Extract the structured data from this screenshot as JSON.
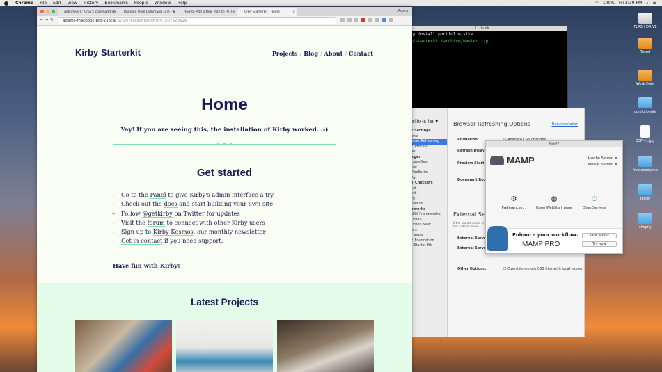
{
  "menubar": {
    "items": [
      "Chrome",
      "File",
      "Edit",
      "View",
      "History",
      "Bookmarks",
      "People",
      "Window",
      "Help"
    ],
    "status": "100%",
    "clock": "Fri 3:39 PM"
  },
  "desktop": {
    "icons": [
      "FLASH DRIVE",
      "Travel",
      "Work Data",
      "portfolio-site",
      "33P—1.jpg",
      "freelancejump",
      "tester",
      "shopify"
    ]
  },
  "terminal": {
    "title": "1. bash",
    "lines": [
      "y install portfolio-site",
      "/starterkit/archive/master.zip"
    ]
  },
  "codekit": {
    "project": "olio-site",
    "sidebar": [
      {
        "t": "t Settings",
        "s": true
      },
      {
        "t": "eral"
      },
      {
        "t": "wser Refreshing",
        "sel": true
      },
      {
        "t": "d Process"
      },
      {
        "t": "ks"
      },
      {
        "t": "ages",
        "s": true
      },
      {
        "t": ""
      },
      {
        "t": "toprefixer"
      },
      {
        "t": "bel"
      },
      {
        "t": "ffeeScript"
      },
      {
        "t": "Py"
      },
      {
        "t": "x Checkers",
        "s": true
      },
      {
        "t": "int"
      },
      {
        "t": "int"
      },
      {
        "t": "nt"
      },
      {
        "t": "feeLint"
      },
      {
        "t": "eworks",
        "s": true
      },
      {
        "t": "eKit Frameworks"
      },
      {
        "t": "urbon"
      },
      {
        "t": "urbon Neat"
      },
      {
        "t": "ars"
      },
      {
        "t": "mpass"
      },
      {
        "t": "b Foundation"
      },
      {
        "t": ""
      },
      {
        "t": "- Starter Kit"
      }
    ],
    "heading": "Browser Refreshing Options",
    "documentation": "Documentation",
    "animation_label": "Animation:",
    "animation_value": "Animate CSS changes",
    "refresh_delay": "Refresh Delay:",
    "preview_path": "Preview Start Path",
    "preview_root": "Document Root S",
    "external_heading": "External Serve",
    "external_text": "If the project needs se and tell CodeKit where",
    "ext_url": "External Server Ur",
    "ext_addr": "External Server Ad",
    "other_label": "Other Options:",
    "other_value": "Override remote CSS files with local copies"
  },
  "mamp": {
    "title": "MAMP",
    "logo": "MAMP",
    "apache": "Apache Server",
    "mysql": "MySQL Server",
    "preferences": "Preferences...",
    "webstart": "Open WebStart page",
    "stop": "Stop Servers",
    "promo_title": "Enhance your workflow:",
    "promo_product": "MAMP PRO",
    "tour": "Take a tour",
    "trynow": "Try now"
  },
  "browser": {
    "tabs": [
      {
        "label": "getkirby/cli: Kirby's command lin"
      },
      {
        "label": "Running from Command Line - Ki"
      },
      {
        "label": "How to Add a New Path to PATH"
      },
      {
        "label": "Kirby Starterkit | Home"
      }
    ],
    "user": "Adam",
    "url_host": "adams-macbook-pro-2.local",
    "url_rest": ":5757/?ckcachecontrol=1507329526"
  },
  "site": {
    "brand": "Kirby Starterkit",
    "menu": [
      "Projects",
      "Blog",
      "About",
      "Contact"
    ],
    "title": "Home",
    "intro": "Yay! If you are seeing this, the installation of Kirby worked. :-)",
    "get_started": "Get started",
    "list": [
      {
        "pre": "Go to the ",
        "link": "Panel",
        "post": " to give Kirby's admin interface a try"
      },
      {
        "pre": "Check out the ",
        "link": "docs",
        "post": " and start building your own site"
      },
      {
        "pre": "Follow ",
        "link": "@getkirby",
        "post": " on Twitter for updates"
      },
      {
        "pre": "Visit the ",
        "link": "forum",
        "post": " to connect with other Kirby users"
      },
      {
        "pre": "Sign up to ",
        "link": "Kirby Kosmos",
        "post": ", our monthly newsletter"
      },
      {
        "pre": "",
        "link": "Get in contact",
        "post": " if you need support."
      }
    ],
    "fun": "Have fun with Kirby!",
    "projects_heading": "Latest Projects"
  }
}
